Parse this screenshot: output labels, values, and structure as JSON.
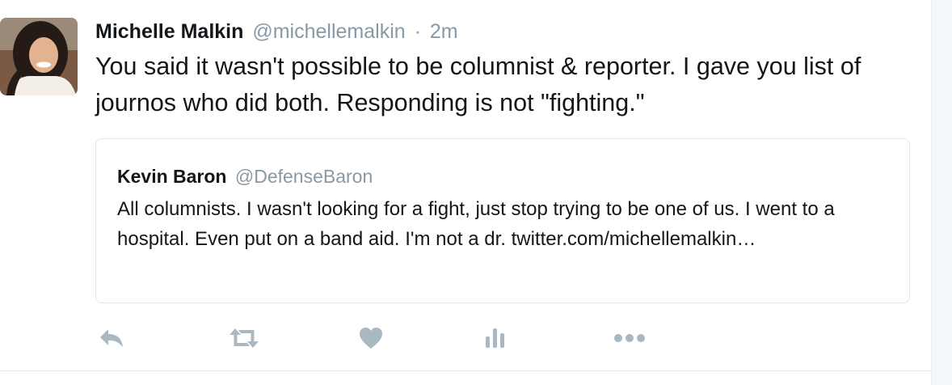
{
  "tweet": {
    "author_name": "Michelle Malkin",
    "author_handle": "@michellemalkin",
    "separator": "·",
    "time": "2m",
    "text": "You said it wasn't possible to be columnist & reporter. I gave you list of journos who did both. Responding is not \"fighting.\""
  },
  "quoted_tweet": {
    "author_name": "Kevin Baron",
    "author_handle": "@DefenseBaron",
    "text": "All columnists. I wasn't looking for a fight, just stop trying to be one of us. I went to a hospital. Even put on a band aid. I'm not a dr. twitter.com/michellemalkin…"
  },
  "actions": [
    {
      "icon": "reply-icon"
    },
    {
      "icon": "retweet-icon"
    },
    {
      "icon": "like-icon"
    },
    {
      "icon": "analytics-icon"
    },
    {
      "icon": "more-icon"
    }
  ],
  "colors": {
    "text": "#14171a",
    "secondary": "#8899a6",
    "icon": "#aab8c2",
    "border": "#e1e8ed"
  }
}
